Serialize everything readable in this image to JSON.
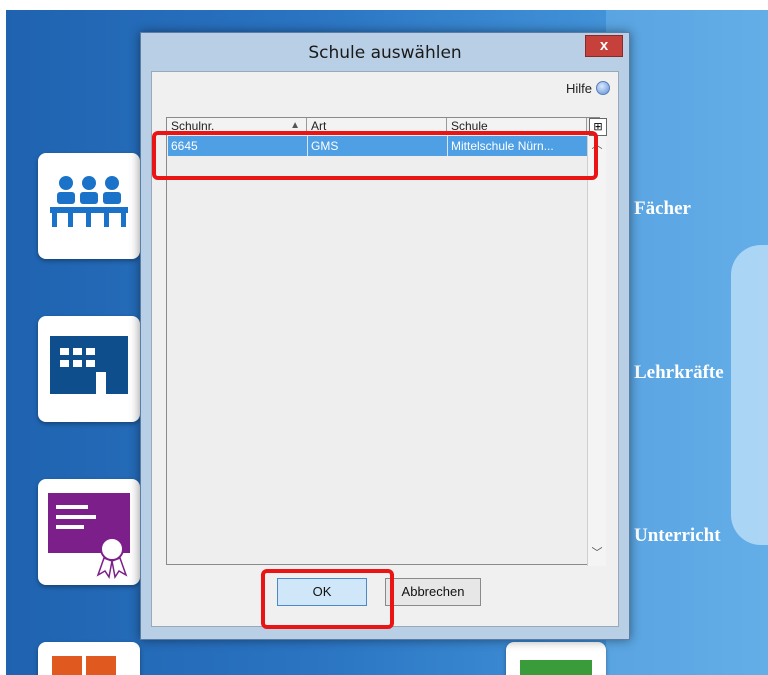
{
  "desktop": {
    "tiles": [
      {
        "label": "Fächer",
        "icon": "classroom-icon",
        "color": "#1a73c9"
      },
      {
        "label": "Lehrkräfte",
        "icon": "building-icon",
        "color": "#0f4e8c"
      },
      {
        "label": "Unterricht",
        "icon": "certificate-icon",
        "color": "#7d1f8a"
      }
    ]
  },
  "dialog": {
    "title": "Schule auswählen",
    "close_label": "x",
    "help_label": "Hilfe",
    "columns": [
      "Schulnr.",
      "Art",
      "Schule"
    ],
    "rows": [
      {
        "schulnr": "6645",
        "art": "GMS",
        "schule": "Mittelschule Nürn..."
      }
    ],
    "ok_label": "OK",
    "cancel_label": "Abbrechen"
  },
  "colors": {
    "highlight": "#ea1414",
    "selection": "#4f9fe4"
  }
}
